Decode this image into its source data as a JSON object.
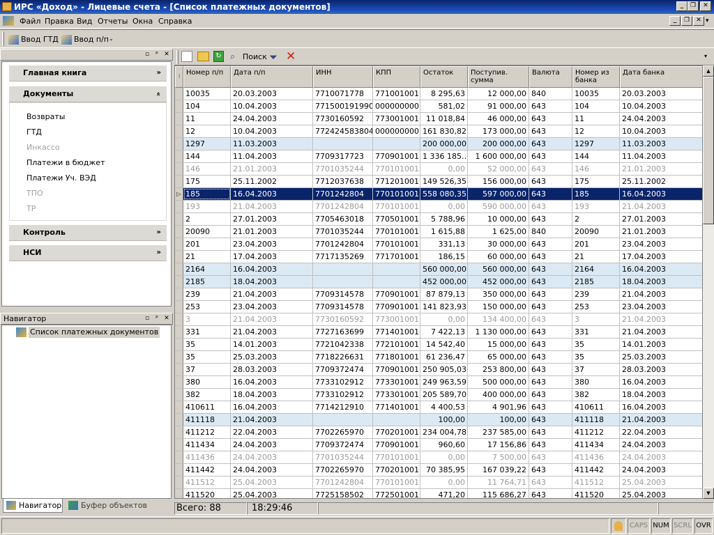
{
  "window": {
    "title": "ИРС «Доход» - Лицевые счета - [Список платежных документов]",
    "minimize": "_",
    "maximize": "❐",
    "close": "✕"
  },
  "menu": [
    "Файл",
    "Правка",
    "Вид",
    "Отчеты",
    "Окна",
    "Справка"
  ],
  "toolbar": {
    "vvod_gtd": "Ввод ГТД",
    "vvod_pp": "Ввод п/п"
  },
  "grid_toolbar": {
    "search": "Поиск"
  },
  "left_panel": {
    "groups": {
      "main_book": "Главная книга",
      "documents": "Документы",
      "control": "Контроль",
      "nsi": "НСИ"
    },
    "documents_items": [
      {
        "label": "Возвраты",
        "disabled": false
      },
      {
        "label": "ГТД",
        "disabled": false
      },
      {
        "label": "Инкассо",
        "disabled": true
      },
      {
        "label": "Платежи в бюджет",
        "disabled": false
      },
      {
        "label": "Платежи Уч. ВЭД",
        "disabled": false
      },
      {
        "label": "ТПО",
        "disabled": true
      },
      {
        "label": "ТР",
        "disabled": true
      }
    ]
  },
  "navigator": {
    "title": "Навигатор",
    "item": "Список платежных документов"
  },
  "bottom_tabs": {
    "navigator": "Навигатор",
    "buffer": "Буфер объектов"
  },
  "grid": {
    "columns": [
      "Номер п/п",
      "Дата п/п",
      "ИНН",
      "КПП",
      "Остаток",
      "Поступив. сумма",
      "Валюта",
      "Номер из банка",
      "Дата банка"
    ],
    "rows": [
      {
        "n": "10035",
        "d": "20.03.2003",
        "inn": "7710071778",
        "kpp": "771001001",
        "ost": "8 295,63",
        "sum": "12 000,00",
        "val": "840",
        "nb": "10035",
        "db": "20.03.2003",
        "style": ""
      },
      {
        "n": "104",
        "d": "10.04.2003",
        "inn": "771500191990",
        "kpp": "000000000",
        "ost": "581,02",
        "sum": "91 000,00",
        "val": "643",
        "nb": "104",
        "db": "10.04.2003",
        "style": ""
      },
      {
        "n": "11",
        "d": "24.04.2003",
        "inn": "7730160592",
        "kpp": "773001001",
        "ost": "11 018,84",
        "sum": "46 000,00",
        "val": "643",
        "nb": "11",
        "db": "24.04.2003",
        "style": ""
      },
      {
        "n": "12",
        "d": "10.04.2003",
        "inn": "772424583804",
        "kpp": "000000000",
        "ost": "161 830,82",
        "sum": "173 000,00",
        "val": "643",
        "nb": "12",
        "db": "10.04.2003",
        "style": ""
      },
      {
        "n": "1297",
        "d": "11.03.2003",
        "inn": "",
        "kpp": "",
        "ost": "200 000,00",
        "sum": "200 000,00",
        "val": "643",
        "nb": "1297",
        "db": "11.03.2003",
        "style": "blue"
      },
      {
        "n": "144",
        "d": "11.04.2003",
        "inn": "7709317723",
        "kpp": "770901001",
        "ost": "1 336 185…",
        "sum": "1 600 000,00",
        "val": "643",
        "nb": "144",
        "db": "11.04.2003",
        "style": ""
      },
      {
        "n": "146",
        "d": "21.01.2003",
        "inn": "7701035244",
        "kpp": "770101001",
        "ost": "0,00",
        "sum": "52 000,00",
        "val": "643",
        "nb": "146",
        "db": "21.01.2003",
        "style": "gray"
      },
      {
        "n": "175",
        "d": "25.11.2002",
        "inn": "7712037638",
        "kpp": "771201001",
        "ost": "149 526,35",
        "sum": "156 000,00",
        "val": "643",
        "nb": "175",
        "db": "25.11.2002",
        "style": ""
      },
      {
        "n": "185",
        "d": "16.04.2003",
        "inn": "7701242804",
        "kpp": "770101001",
        "ost": "558 080,35",
        "sum": "597 000,00",
        "val": "643",
        "nb": "185",
        "db": "16.04.2003",
        "style": "sel"
      },
      {
        "n": "193",
        "d": "21.04.2003",
        "inn": "7701242804",
        "kpp": "770101001",
        "ost": "0,00",
        "sum": "590 000,00",
        "val": "643",
        "nb": "193",
        "db": "21.04.2003",
        "style": "gray"
      },
      {
        "n": "2",
        "d": "27.01.2003",
        "inn": "7705463018",
        "kpp": "770501001",
        "ost": "5 788,96",
        "sum": "10 000,00",
        "val": "643",
        "nb": "2",
        "db": "27.01.2003",
        "style": ""
      },
      {
        "n": "20090",
        "d": "21.01.2003",
        "inn": "7701035244",
        "kpp": "770101001",
        "ost": "1 615,88",
        "sum": "1 625,00",
        "val": "840",
        "nb": "20090",
        "db": "21.01.2003",
        "style": ""
      },
      {
        "n": "201",
        "d": "23.04.2003",
        "inn": "7701242804",
        "kpp": "770101001",
        "ost": "331,13",
        "sum": "30 000,00",
        "val": "643",
        "nb": "201",
        "db": "23.04.2003",
        "style": ""
      },
      {
        "n": "21",
        "d": "17.04.2003",
        "inn": "7717135269",
        "kpp": "771701001",
        "ost": "186,15",
        "sum": "60 000,00",
        "val": "643",
        "nb": "21",
        "db": "17.04.2003",
        "style": ""
      },
      {
        "n": "2164",
        "d": "16.04.2003",
        "inn": "",
        "kpp": "",
        "ost": "560 000,00",
        "sum": "560 000,00",
        "val": "643",
        "nb": "2164",
        "db": "16.04.2003",
        "style": "blue"
      },
      {
        "n": "2185",
        "d": "18.04.2003",
        "inn": "",
        "kpp": "",
        "ost": "452 000,00",
        "sum": "452 000,00",
        "val": "643",
        "nb": "2185",
        "db": "18.04.2003",
        "style": "blue"
      },
      {
        "n": "239",
        "d": "21.04.2003",
        "inn": "7709314578",
        "kpp": "770901001",
        "ost": "87 879,13",
        "sum": "350 000,00",
        "val": "643",
        "nb": "239",
        "db": "21.04.2003",
        "style": ""
      },
      {
        "n": "253",
        "d": "23.04.2003",
        "inn": "7709314578",
        "kpp": "770901001",
        "ost": "141 823,93",
        "sum": "150 000,00",
        "val": "643",
        "nb": "253",
        "db": "23.04.2003",
        "style": ""
      },
      {
        "n": "3",
        "d": "21.04.2003",
        "inn": "7730160592",
        "kpp": "773001001",
        "ost": "0,00",
        "sum": "134 400,00",
        "val": "643",
        "nb": "3",
        "db": "21.04.2003",
        "style": "gray"
      },
      {
        "n": "331",
        "d": "21.04.2003",
        "inn": "7727163699",
        "kpp": "771401001",
        "ost": "7 422,13",
        "sum": "1 130 000,00",
        "val": "643",
        "nb": "331",
        "db": "21.04.2003",
        "style": ""
      },
      {
        "n": "35",
        "d": "14.01.2003",
        "inn": "7721042338",
        "kpp": "772101001",
        "ost": "14 542,40",
        "sum": "15 000,00",
        "val": "643",
        "nb": "35",
        "db": "14.01.2003",
        "style": ""
      },
      {
        "n": "35",
        "d": "25.03.2003",
        "inn": "7718226631",
        "kpp": "771801001",
        "ost": "61 236,47",
        "sum": "65 000,00",
        "val": "643",
        "nb": "35",
        "db": "25.03.2003",
        "style": ""
      },
      {
        "n": "37",
        "d": "28.03.2003",
        "inn": "7709372474",
        "kpp": "770901001",
        "ost": "250 905,03",
        "sum": "253 800,00",
        "val": "643",
        "nb": "37",
        "db": "28.03.2003",
        "style": ""
      },
      {
        "n": "380",
        "d": "16.04.2003",
        "inn": "7733102912",
        "kpp": "773301001",
        "ost": "249 963,59",
        "sum": "500 000,00",
        "val": "643",
        "nb": "380",
        "db": "16.04.2003",
        "style": ""
      },
      {
        "n": "382",
        "d": "18.04.2003",
        "inn": "7733102912",
        "kpp": "773301001",
        "ost": "205 589,70",
        "sum": "400 000,00",
        "val": "643",
        "nb": "382",
        "db": "18.04.2003",
        "style": ""
      },
      {
        "n": "410611",
        "d": "16.04.2003",
        "inn": "7714212910",
        "kpp": "771401001",
        "ost": "4 400,53",
        "sum": "4 901,96",
        "val": "643",
        "nb": "410611",
        "db": "16.04.2003",
        "style": ""
      },
      {
        "n": "411118",
        "d": "21.04.2003",
        "inn": "",
        "kpp": "",
        "ost": "100,00",
        "sum": "100,00",
        "val": "643",
        "nb": "411118",
        "db": "21.04.2003",
        "style": "blue"
      },
      {
        "n": "411212",
        "d": "22.04.2003",
        "inn": "7702265970",
        "kpp": "770201001",
        "ost": "234 004,78",
        "sum": "237 585,00",
        "val": "643",
        "nb": "411212",
        "db": "22.04.2003",
        "style": ""
      },
      {
        "n": "411434",
        "d": "24.04.2003",
        "inn": "7709372474",
        "kpp": "770901001",
        "ost": "960,60",
        "sum": "17 156,86",
        "val": "643",
        "nb": "411434",
        "db": "24.04.2003",
        "style": ""
      },
      {
        "n": "411436",
        "d": "24.04.2003",
        "inn": "7701035244",
        "kpp": "770101001",
        "ost": "0,00",
        "sum": "7 500,00",
        "val": "643",
        "nb": "411436",
        "db": "24.04.2003",
        "style": "gray"
      },
      {
        "n": "411442",
        "d": "24.04.2003",
        "inn": "7702265970",
        "kpp": "770201001",
        "ost": "70 385,95",
        "sum": "167 039,22",
        "val": "643",
        "nb": "411442",
        "db": "24.04.2003",
        "style": ""
      },
      {
        "n": "411512",
        "d": "25.04.2003",
        "inn": "7701242804",
        "kpp": "770101001",
        "ost": "0,00",
        "sum": "11 764,71",
        "val": "643",
        "nb": "411512",
        "db": "25.04.2003",
        "style": "gray"
      },
      {
        "n": "411520",
        "d": "25.04.2003",
        "inn": "7725158502",
        "kpp": "772501001",
        "ost": "471,20",
        "sum": "115 686,27",
        "val": "643",
        "nb": "411520",
        "db": "25.04.2003",
        "style": ""
      }
    ]
  },
  "grid_status": {
    "total": "Всего: 88",
    "time": "18:29:46"
  },
  "statusbar": [
    "CAPS",
    "NUM",
    "SCRL",
    "OVR"
  ]
}
